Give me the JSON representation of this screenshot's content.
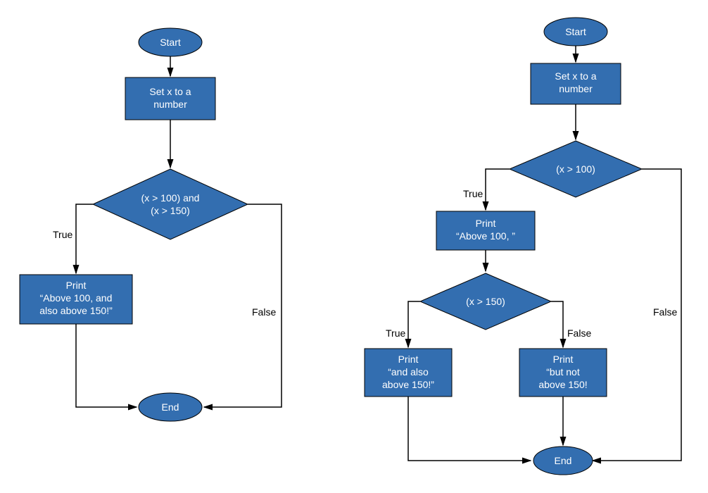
{
  "left": {
    "start": "Start",
    "set": {
      "l1": "Set x to a",
      "l2": "number"
    },
    "cond": {
      "l1": "(x > 100) and",
      "l2": "(x > 150)"
    },
    "trueLabel": "True",
    "falseLabel": "False",
    "print": {
      "l1": "Print",
      "l2": "“Above 100, and",
      "l3": "also above 150!”"
    },
    "end": "End"
  },
  "right": {
    "start": "Start",
    "set": {
      "l1": "Set x to a",
      "l2": "number"
    },
    "cond1": "(x > 100)",
    "cond1TrueLabel": "True",
    "cond1FalseLabel": "False",
    "print1": {
      "l1": "Print",
      "l2": "“Above 100, ”"
    },
    "cond2": "(x > 150)",
    "cond2TrueLabel": "True",
    "cond2FalseLabel": "False",
    "print2a": {
      "l1": "Print",
      "l2": "“and also",
      "l3": "above 150!”"
    },
    "print2b": {
      "l1": "Print",
      "l2": "“but not",
      "l3": "above 150!"
    },
    "end": "End"
  }
}
